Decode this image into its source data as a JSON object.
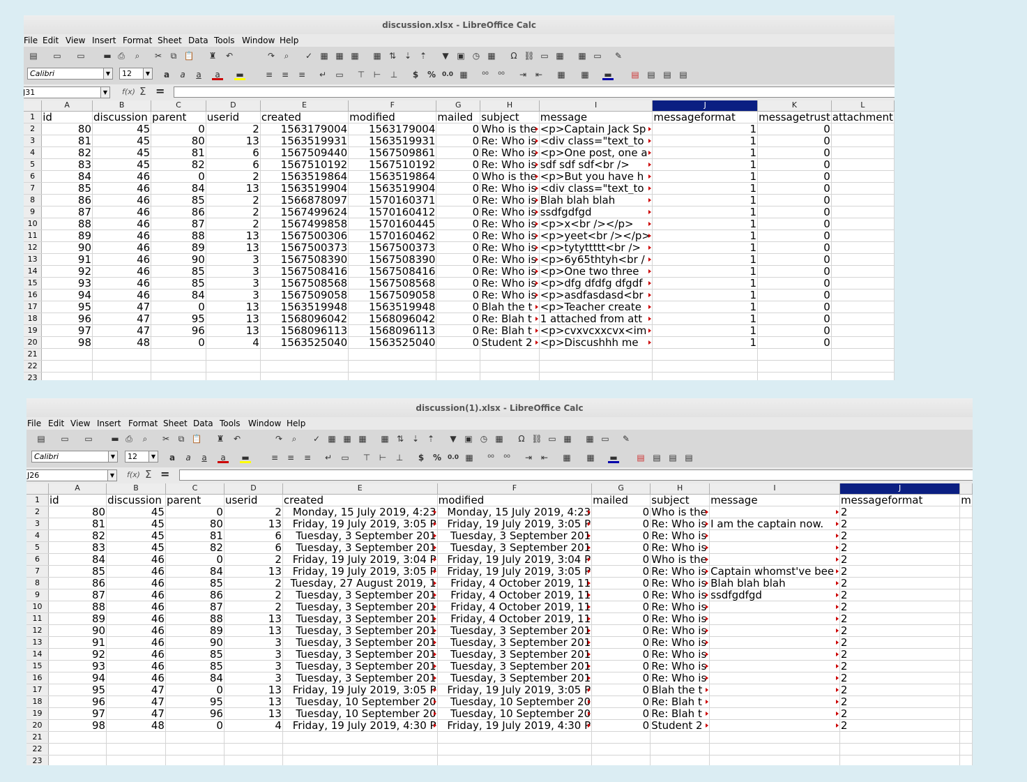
{
  "window1": {
    "title": "discussion.xlsx - LibreOffice Calc",
    "menu": [
      "File",
      "Edit",
      "View",
      "Insert",
      "Format",
      "Sheet",
      "Data",
      "Tools",
      "Window",
      "Help"
    ],
    "font_name": "Calibri",
    "font_size": "12",
    "name_box": "J31",
    "columns": [
      "A",
      "B",
      "C",
      "D",
      "E",
      "F",
      "G",
      "H",
      "I",
      "J",
      "K",
      "L"
    ],
    "selected_column": "J",
    "header_row": [
      "id",
      "discussion",
      "parent",
      "userid",
      "created",
      "modified",
      "mailed",
      "subject",
      "message",
      "messageformat",
      "messagetrust",
      "attachment"
    ],
    "rows": [
      [
        "80",
        "45",
        "0",
        "2",
        "1563179004",
        "1563179004",
        "0",
        "Who is the",
        "<p>Captain Jack Sp",
        "1",
        "0"
      ],
      [
        "81",
        "45",
        "80",
        "13",
        "1563519931",
        "1563519931",
        "0",
        "Re: Who is",
        "<div class=\"text_to",
        "1",
        "0"
      ],
      [
        "82",
        "45",
        "81",
        "6",
        "1567509440",
        "1567509861",
        "0",
        "Re: Who is",
        "<p>One post, one a",
        "1",
        "0"
      ],
      [
        "83",
        "45",
        "82",
        "6",
        "1567510192",
        "1567510192",
        "0",
        "Re: Who is",
        "sdf sdf sdf<br />",
        "1",
        "0"
      ],
      [
        "84",
        "46",
        "0",
        "2",
        "1563519864",
        "1563519864",
        "0",
        "Who is the",
        "<p>But you have h",
        "1",
        "0"
      ],
      [
        "85",
        "46",
        "84",
        "13",
        "1563519904",
        "1563519904",
        "0",
        "Re: Who is",
        "<div class=\"text_to",
        "1",
        "0"
      ],
      [
        "86",
        "46",
        "85",
        "2",
        "1566878097",
        "1570160371",
        "0",
        "Re: Who is",
        "Blah blah blah",
        "1",
        "0"
      ],
      [
        "87",
        "46",
        "86",
        "2",
        "1567499624",
        "1570160412",
        "0",
        "Re: Who is",
        "ssdfgdfgd",
        "1",
        "0"
      ],
      [
        "88",
        "46",
        "87",
        "2",
        "1567499858",
        "1570160445",
        "0",
        "Re: Who is",
        "<p>x<br /></p>",
        "1",
        "0"
      ],
      [
        "89",
        "46",
        "88",
        "13",
        "1567500306",
        "1570160462",
        "0",
        "Re: Who is",
        "<p>yeet<br /></p>",
        "1",
        "0"
      ],
      [
        "90",
        "46",
        "89",
        "13",
        "1567500373",
        "1567500373",
        "0",
        "Re: Who is",
        "<p>tytyttttt<br />",
        "1",
        "0"
      ],
      [
        "91",
        "46",
        "90",
        "3",
        "1567508390",
        "1567508390",
        "0",
        "Re: Who is",
        "<p>6y65thtyh<br /",
        "1",
        "0"
      ],
      [
        "92",
        "46",
        "85",
        "3",
        "1567508416",
        "1567508416",
        "0",
        "Re: Who is",
        "<p>One two three",
        "1",
        "0"
      ],
      [
        "93",
        "46",
        "85",
        "3",
        "1567508568",
        "1567508568",
        "0",
        "Re: Who is",
        "<p>dfg dfdfg dfgdf",
        "1",
        "0"
      ],
      [
        "94",
        "46",
        "84",
        "3",
        "1567509058",
        "1567509058",
        "0",
        "Re: Who is",
        "<p>asdfasdasd<br",
        "1",
        "0"
      ],
      [
        "95",
        "47",
        "0",
        "13",
        "1563519948",
        "1563519948",
        "0",
        "Blah the t",
        "<p>Teacher create",
        "1",
        "0"
      ],
      [
        "96",
        "47",
        "95",
        "13",
        "1568096042",
        "1568096042",
        "0",
        "Re: Blah t",
        "1 attached from att",
        "1",
        "0"
      ],
      [
        "97",
        "47",
        "96",
        "13",
        "1568096113",
        "1568096113",
        "0",
        "Re: Blah t",
        "<p>cvxvcxxcvx<im",
        "1",
        "0"
      ],
      [
        "98",
        "48",
        "0",
        "4",
        "1563525040",
        "1563525040",
        "0",
        "Student 2",
        "<p>Discushhh me",
        "1",
        "0"
      ]
    ]
  },
  "window2": {
    "title": "discussion(1).xlsx - LibreOffice Calc",
    "menu": [
      "File",
      "Edit",
      "View",
      "Insert",
      "Format",
      "Sheet",
      "Data",
      "Tools",
      "Window",
      "Help"
    ],
    "font_name": "Calibri",
    "font_size": "12",
    "name_box": "J26",
    "columns": [
      "A",
      "B",
      "C",
      "D",
      "E",
      "F",
      "G",
      "H",
      "I",
      "J",
      ""
    ],
    "selected_column": "J",
    "header_row": [
      "id",
      "discussion",
      "parent",
      "userid",
      "created",
      "modified",
      "mailed",
      "subject",
      "message",
      "messageformat",
      "m"
    ],
    "rows": [
      [
        "80",
        "45",
        "0",
        "2",
        "Monday, 15 July 2019, 4:23",
        "Monday, 15 July 2019, 4:23",
        "0",
        "Who is the",
        "",
        "2"
      ],
      [
        "81",
        "45",
        "80",
        "13",
        "Friday, 19 July 2019, 3:05 P",
        "Friday, 19 July 2019, 3:05 P",
        "0",
        "Re: Who is",
        "I am the captain now.",
        "2"
      ],
      [
        "82",
        "45",
        "81",
        "6",
        "Tuesday, 3 September 201",
        "Tuesday, 3 September 201",
        "0",
        "Re: Who is",
        "",
        "2"
      ],
      [
        "83",
        "45",
        "82",
        "6",
        "Tuesday, 3 September 201",
        "Tuesday, 3 September 201",
        "0",
        "Re: Who is",
        "",
        "2"
      ],
      [
        "84",
        "46",
        "0",
        "2",
        "Friday, 19 July 2019, 3:04 P",
        "Friday, 19 July 2019, 3:04 P",
        "0",
        "Who is the",
        "",
        "2"
      ],
      [
        "85",
        "46",
        "84",
        "13",
        "Friday, 19 July 2019, 3:05 P",
        "Friday, 19 July 2019, 3:05 P",
        "0",
        "Re: Who is",
        "Captain whomst've bee",
        "2"
      ],
      [
        "86",
        "46",
        "85",
        "2",
        "Tuesday, 27 August 2019, 1",
        "Friday, 4 October 2019, 11",
        "0",
        "Re: Who is",
        "Blah blah blah",
        "2"
      ],
      [
        "87",
        "46",
        "86",
        "2",
        "Tuesday, 3 September 201",
        "Friday, 4 October 2019, 11",
        "0",
        "Re: Who is",
        "ssdfgdfgd",
        "2"
      ],
      [
        "88",
        "46",
        "87",
        "2",
        "Tuesday, 3 September 201",
        "Friday, 4 October 2019, 11",
        "0",
        "Re: Who is",
        "",
        "2"
      ],
      [
        "89",
        "46",
        "88",
        "13",
        "Tuesday, 3 September 201",
        "Friday, 4 October 2019, 11",
        "0",
        "Re: Who is",
        "",
        "2"
      ],
      [
        "90",
        "46",
        "89",
        "13",
        "Tuesday, 3 September 201",
        "Tuesday, 3 September 201",
        "0",
        "Re: Who is",
        "",
        "2"
      ],
      [
        "91",
        "46",
        "90",
        "3",
        "Tuesday, 3 September 201",
        "Tuesday, 3 September 201",
        "0",
        "Re: Who is",
        "",
        "2"
      ],
      [
        "92",
        "46",
        "85",
        "3",
        "Tuesday, 3 September 201",
        "Tuesday, 3 September 201",
        "0",
        "Re: Who is",
        "",
        "2"
      ],
      [
        "93",
        "46",
        "85",
        "3",
        "Tuesday, 3 September 201",
        "Tuesday, 3 September 201",
        "0",
        "Re: Who is",
        "",
        "2"
      ],
      [
        "94",
        "46",
        "84",
        "3",
        "Tuesday, 3 September 201",
        "Tuesday, 3 September 201",
        "0",
        "Re: Who is",
        "",
        "2"
      ],
      [
        "95",
        "47",
        "0",
        "13",
        "Friday, 19 July 2019, 3:05 P",
        "Friday, 19 July 2019, 3:05 P",
        "0",
        "Blah the t",
        "",
        "2"
      ],
      [
        "96",
        "47",
        "95",
        "13",
        "Tuesday, 10 September 20",
        "Tuesday, 10 September 20",
        "0",
        "Re: Blah t",
        "",
        "2"
      ],
      [
        "97",
        "47",
        "96",
        "13",
        "Tuesday, 10 September 20",
        "Tuesday, 10 September 20",
        "0",
        "Re: Blah t",
        "",
        "2"
      ],
      [
        "98",
        "48",
        "0",
        "4",
        "Friday, 19 July 2019, 4:30 P",
        "Friday, 19 July 2019, 4:30 P",
        "0",
        "Student 2",
        "",
        "2"
      ]
    ]
  },
  "row_numbers": [
    "1",
    "2",
    "3",
    "4",
    "5",
    "6",
    "7",
    "8",
    "9",
    "10",
    "11",
    "12",
    "13",
    "14",
    "15",
    "16",
    "17",
    "18",
    "19",
    "20",
    "21",
    "22",
    "23"
  ],
  "icons": {
    "sum": "Σ",
    "equals": "=",
    "function_wizard": "f(x)"
  }
}
